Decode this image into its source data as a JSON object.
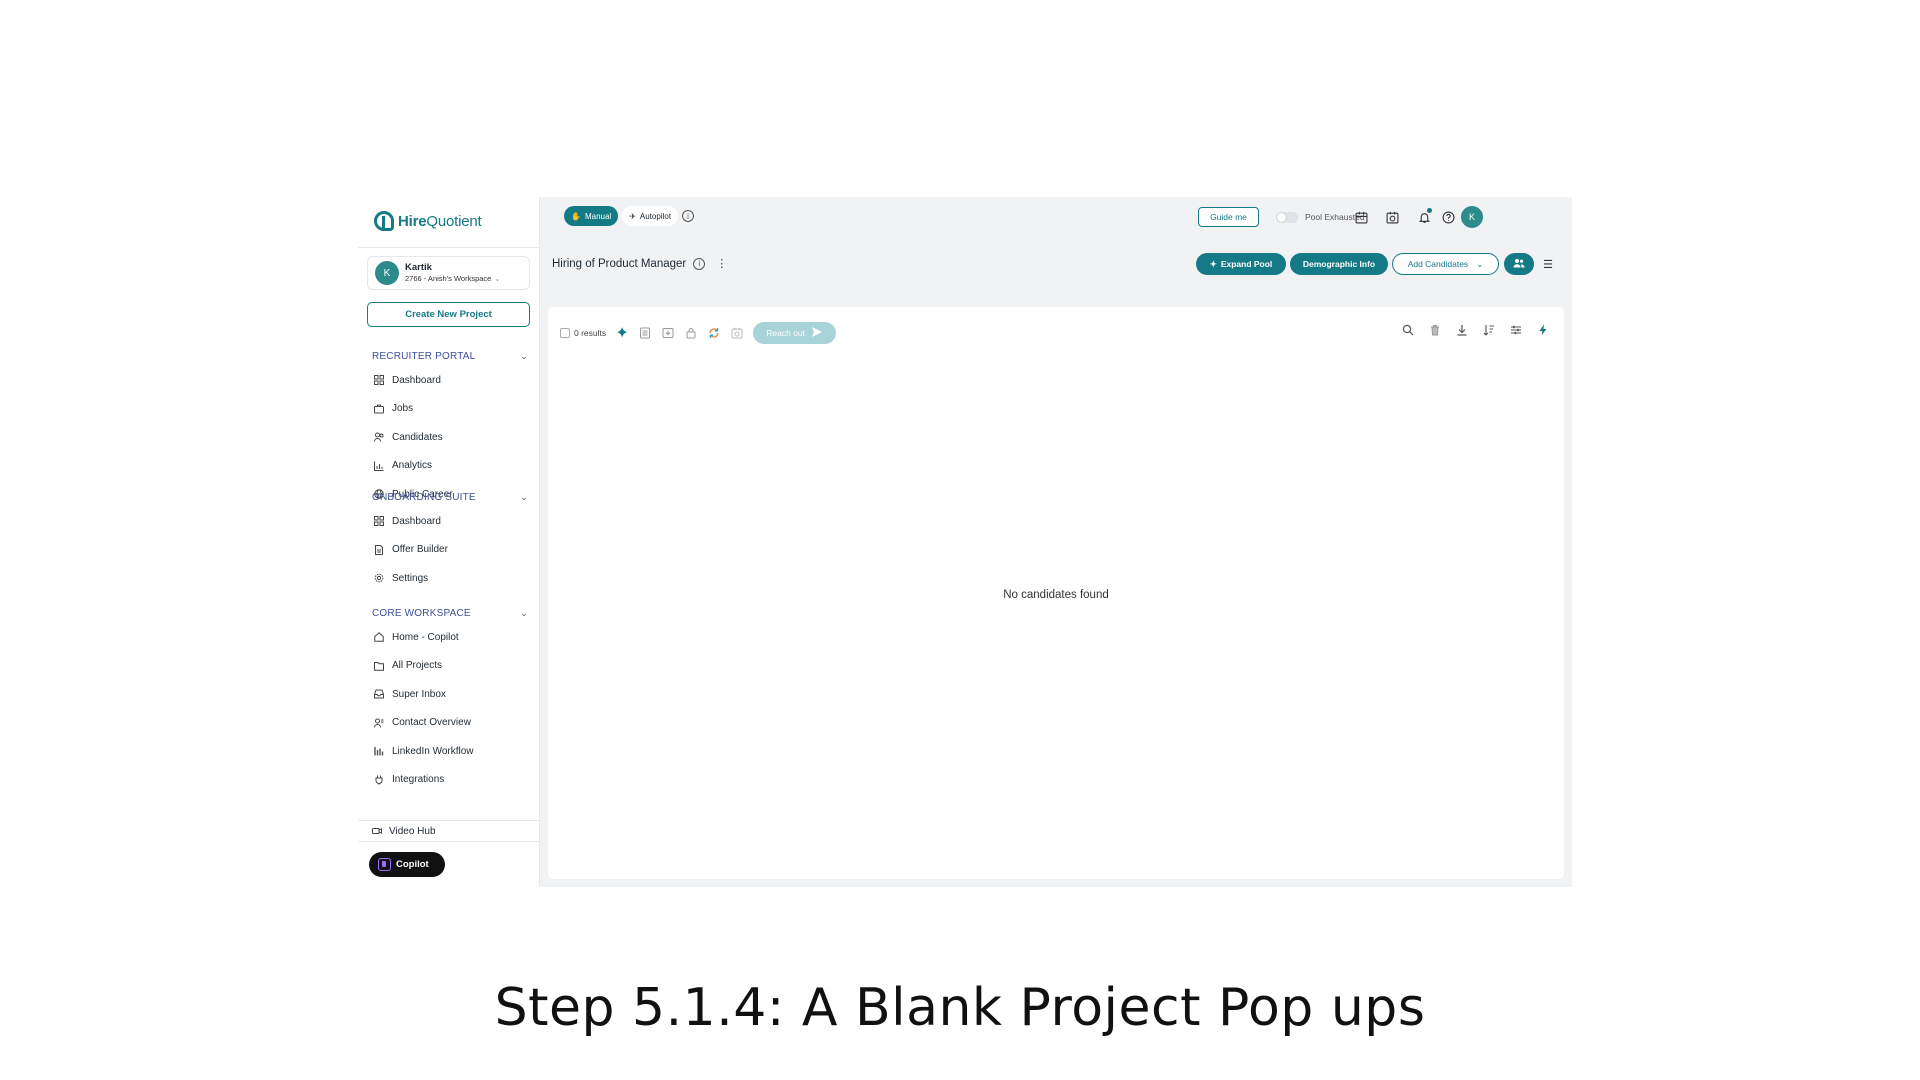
{
  "brand": {
    "name_part1": "Hire",
    "name_part2": "Quotient"
  },
  "user": {
    "initial": "K",
    "name": "Kartik",
    "workspace": "2766 - Anish's Workspace"
  },
  "sidebar": {
    "create_button": "Create New Project",
    "sections": [
      {
        "title": "RECRUITER PORTAL",
        "items": [
          {
            "label": "Dashboard",
            "icon": "dashboard-icon"
          },
          {
            "label": "Jobs",
            "icon": "briefcase-icon"
          },
          {
            "label": "Candidates",
            "icon": "users-icon"
          },
          {
            "label": "Analytics",
            "icon": "bar-chart-icon"
          },
          {
            "label": "Public Career",
            "icon": "globe-icon"
          }
        ]
      },
      {
        "title": "ONBOARDING SUITE",
        "items": [
          {
            "label": "Dashboard",
            "icon": "dashboard-icon"
          },
          {
            "label": "Offer Builder",
            "icon": "document-icon"
          },
          {
            "label": "Settings",
            "icon": "gear-icon"
          }
        ]
      },
      {
        "title": "CORE WORKSPACE",
        "items": [
          {
            "label": "Home - Copilot",
            "icon": "home-icon"
          },
          {
            "label": "All Projects",
            "icon": "folder-icon"
          },
          {
            "label": "Super Inbox",
            "icon": "inbox-icon"
          },
          {
            "label": "Contact Overview",
            "icon": "contacts-icon"
          },
          {
            "label": "LinkedIn Workflow",
            "icon": "workflow-icon"
          },
          {
            "label": "Integrations",
            "icon": "plug-icon"
          }
        ]
      }
    ],
    "video_hub": "Video Hub",
    "copilot": "Copilot"
  },
  "topbar": {
    "mode_manual": "Manual",
    "mode_autopilot": "Autopilot",
    "guide_me": "Guide me",
    "pool_exhausted": "Pool Exhausted",
    "avatar_initial": "K"
  },
  "project": {
    "title": "Hiring of Product Manager",
    "expand_pool": "Expand Pool",
    "demographic_info": "Demographic Info",
    "add_candidates": "Add Candidates"
  },
  "results": {
    "count_text": "0 results",
    "reach_out": "Reach out",
    "empty_message": "No candidates found"
  },
  "caption": "Step 5.1.4: A Blank Project Pop ups",
  "colors": {
    "accent": "#147a86",
    "section_title": "#3b4f9a",
    "reach_disabled": "#a8d3d8"
  }
}
